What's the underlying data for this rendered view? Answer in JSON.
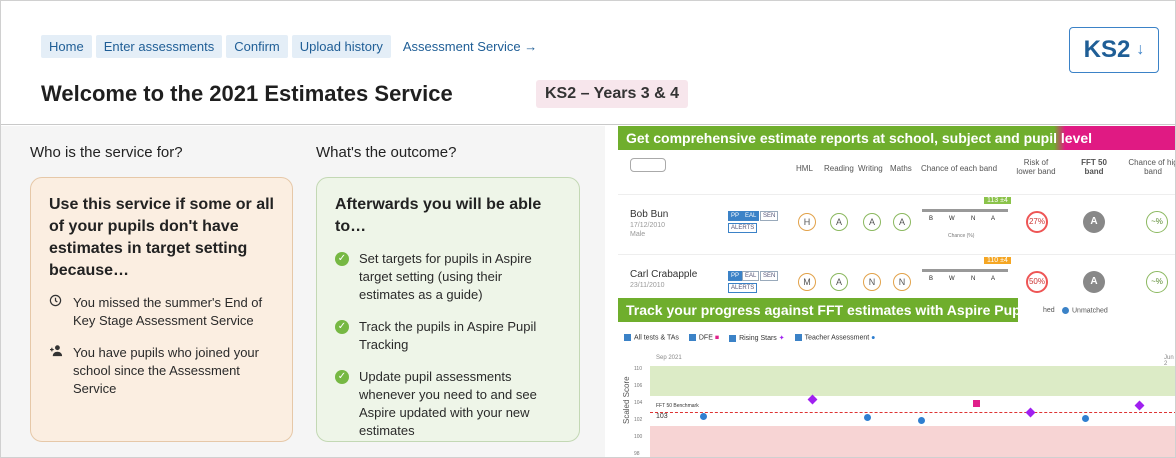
{
  "breadcrumb": {
    "items": [
      "Home",
      "Enter assessments",
      "Confirm",
      "Upload history"
    ],
    "external": "Assessment Service →"
  },
  "header": {
    "title": "Welcome to the 2021 Estimates Service",
    "tag": "KS2 – Years 3 & 4",
    "ks_button": "KS2",
    "ks_arrow": "↓"
  },
  "who": {
    "heading": "Who is the service for?",
    "card_title": "Use this service if some or all of your pupils don't have estimates in target setting because…",
    "items": [
      "You missed the summer's End of Key Stage Assessment Service",
      "You have pupils who joined your school since the Assessment Service"
    ]
  },
  "outcome": {
    "heading": "What's the outcome?",
    "card_title": "Afterwards you will be able to…",
    "items": [
      "Set targets for pupils in Aspire target setting (using their estimates as a guide)",
      "Track the pupils in Aspire Pupil Tracking",
      "Update pupil assessments whenever you need to and see Aspire updated with your new estimates"
    ]
  },
  "reports": {
    "banner": "Get comprehensive estimate reports at school, subject and pupil level",
    "columns": [
      "HML",
      "Reading",
      "Writing",
      "Maths",
      "Chance of each band",
      "Risk of lower band",
      "FFT 50 band",
      "Chance of hig band"
    ],
    "pupils": [
      {
        "name": "Bob Bun",
        "dob": "17/12/2010",
        "gender": "Male",
        "grades": [
          "H",
          "A",
          "A",
          "A"
        ],
        "band": "113 ±4",
        "risk": "27%",
        "fft": "A",
        "chance": "~%"
      },
      {
        "name": "Carl Crabapple",
        "dob": "23/11/2010",
        "gender": "Male",
        "grades": [
          "M",
          "A",
          "N",
          "N"
        ],
        "band": "110 ±4",
        "risk": "50%",
        "fft": "A",
        "chance": "~%"
      }
    ],
    "pills": [
      "PP",
      "EAL",
      "SEN"
    ],
    "alerts": "ALERTS",
    "band_letters": [
      "B",
      "W",
      "N",
      "A"
    ],
    "chance_label": "Chance (%)"
  },
  "tracking": {
    "banner": "Track your progress against FFT estimates with Aspire Pupil Tracking",
    "behind_banner": "hed",
    "unmatched": "Unmatched",
    "legend": [
      "All tests & TAs",
      "DFE",
      "Rising Stars",
      "Teacher Assessment"
    ],
    "date_left": "Sep 2021",
    "date_right": "Jun 2",
    "benchmark": "FFT 50 Benchmark",
    "benchmark_value": "103",
    "y_label": "Scaled Score",
    "y_ticks": [
      "110",
      "106",
      "104",
      "102",
      "100",
      "98"
    ]
  }
}
